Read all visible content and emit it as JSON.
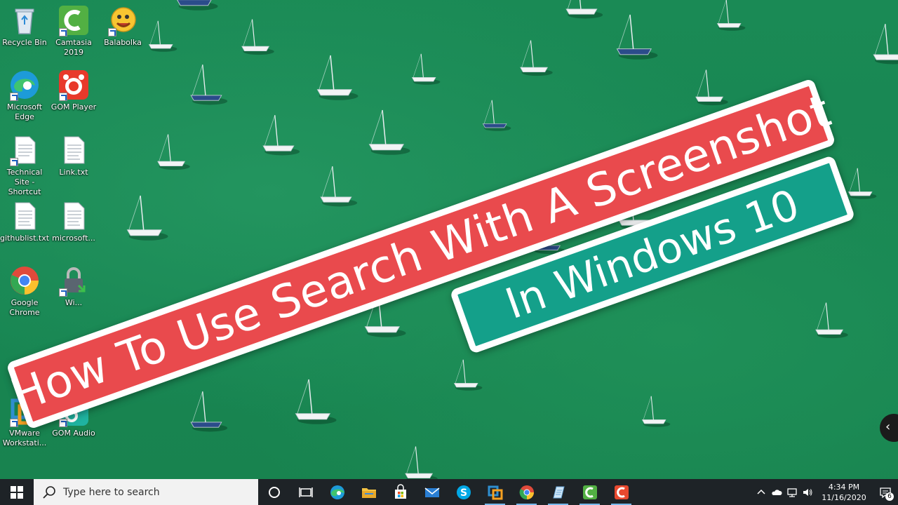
{
  "desktop": {
    "icons": [
      {
        "label": "Recycle Bin",
        "icon": "recycle-bin-icon"
      },
      {
        "label": "Camtasia 2019",
        "icon": "camtasia-icon"
      },
      {
        "label": "Balabolka",
        "icon": "balabolka-icon"
      },
      {
        "label": "Microsoft Edge",
        "icon": "edge-icon"
      },
      {
        "label": "GOM Player",
        "icon": "gom-player-icon"
      },
      {
        "label": "Technical Site - Shortcut",
        "icon": "document-icon"
      },
      {
        "label": "Link.txt",
        "icon": "text-file-icon"
      },
      {
        "label": "githublist.txt",
        "icon": "text-file-icon"
      },
      {
        "label": "microsoft...",
        "icon": "text-file-icon"
      },
      {
        "label": "Google Chrome",
        "icon": "chrome-icon"
      },
      {
        "label": "Wi...",
        "icon": "lock-app-icon"
      },
      {
        "label": "VMware Workstati...",
        "icon": "vmware-icon"
      },
      {
        "label": "GOM Audio",
        "icon": "gom-audio-icon"
      }
    ]
  },
  "banner": {
    "title": "How To Use Search With A Screenshot",
    "subtitle": "In Windows 10",
    "title_color": "#e94a4d",
    "subtitle_color": "#14a08a"
  },
  "taskbar": {
    "search_placeholder": "Type here to search",
    "pinned": [
      "cortana-icon",
      "task-view-icon",
      "edge-icon",
      "file-explorer-icon",
      "store-icon",
      "mail-icon",
      "skype-icon",
      "vmware-icon",
      "chrome-icon",
      "notepad-icon",
      "camtasia-icon",
      "camtasia-recorder-icon"
    ],
    "clock_time": "4:34 PM",
    "clock_date": "11/16/2020",
    "notification_count": "6"
  },
  "colors": {
    "wallpaper": "#1a8a55",
    "taskbar": "#1e2327",
    "accent": "#76b9ed"
  }
}
